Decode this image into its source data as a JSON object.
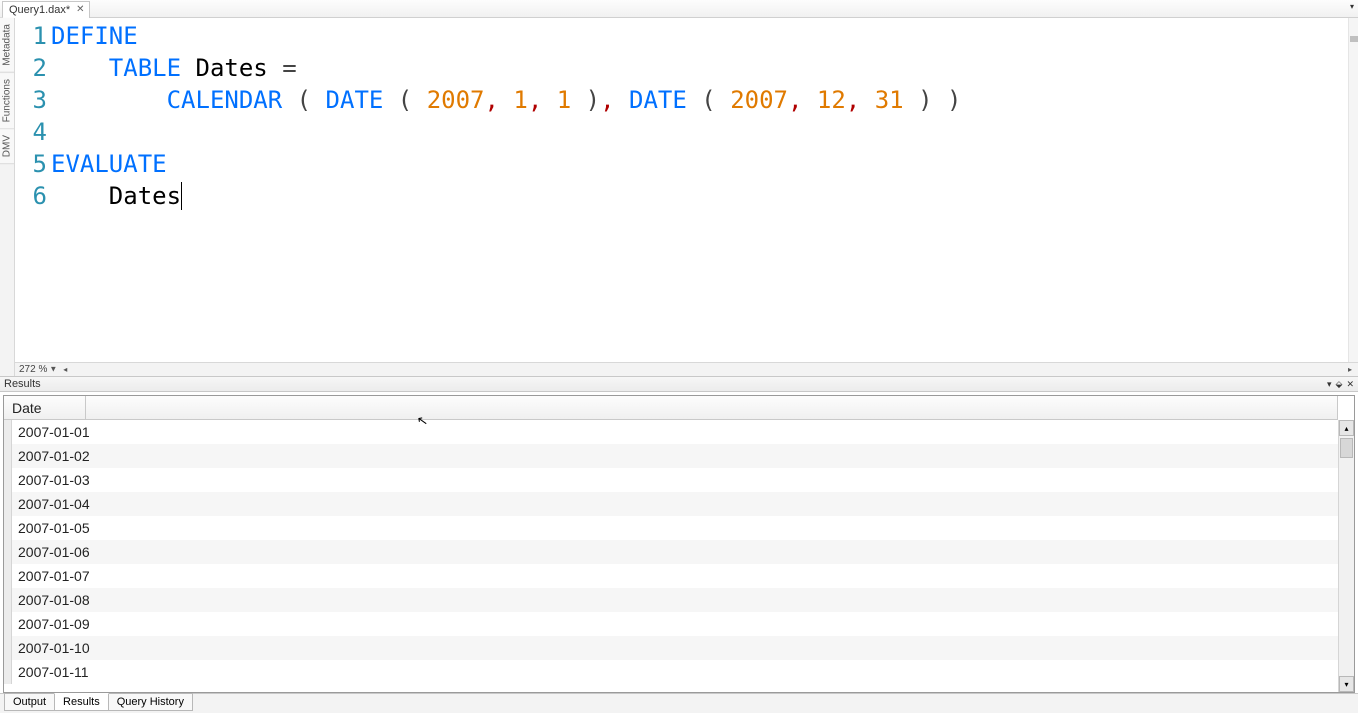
{
  "tabs": {
    "file": "Query1.dax*"
  },
  "side_tabs": [
    "Metadata",
    "Functions",
    "DMV"
  ],
  "zoom": "272 %",
  "code": {
    "l1": {
      "kw": "DEFINE"
    },
    "l2": {
      "kw": "TABLE",
      "ident": "Dates",
      "eq": "="
    },
    "l3": {
      "fn1": "CALENDAR",
      "lp1": "(",
      "fn2": "DATE",
      "lp2": "(",
      "n1": "2007",
      "c1": ",",
      "n2": "1",
      "c2": ",",
      "n3": "1",
      "rp2": ")",
      "c3": ",",
      "fn3": "DATE",
      "lp3": "(",
      "n4": "2007",
      "c4": ",",
      "n5": "12",
      "c5": ",",
      "n6": "31",
      "rp3": ")",
      "rp1": ")"
    },
    "l5": {
      "kw": "EVALUATE"
    },
    "l6": {
      "ident": "Dates"
    }
  },
  "results": {
    "title": "Results",
    "header": "Date",
    "rows": [
      "2007-01-01",
      "2007-01-02",
      "2007-01-03",
      "2007-01-04",
      "2007-01-05",
      "2007-01-06",
      "2007-01-07",
      "2007-01-08",
      "2007-01-09",
      "2007-01-10",
      "2007-01-11"
    ]
  },
  "bottom_tabs": {
    "output": "Output",
    "results": "Results",
    "history": "Query History"
  }
}
